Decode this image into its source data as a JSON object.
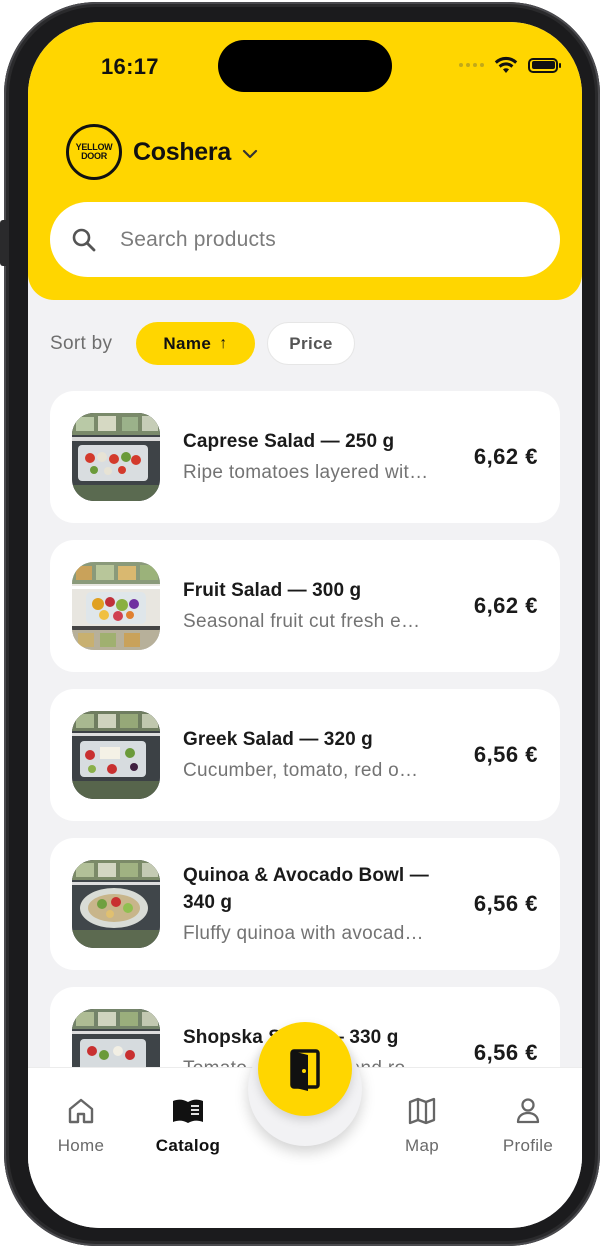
{
  "status_bar": {
    "time": "16:17"
  },
  "header": {
    "logo_line1": "YELLOW",
    "logo_line2": "DOOR",
    "store_name": "Coshera"
  },
  "search": {
    "placeholder": "Search products",
    "value": ""
  },
  "sort": {
    "label": "Sort by",
    "options": [
      {
        "label": "Name",
        "active": true,
        "direction": "↑"
      },
      {
        "label": "Price",
        "active": false
      }
    ]
  },
  "products": [
    {
      "title": "Caprese Salad — 250 g",
      "description": "Ripe tomatoes layered wit…",
      "price": "6,62 €"
    },
    {
      "title": "Fruit Salad — 300 g",
      "description": "Seasonal fruit cut fresh e…",
      "price": "6,62 €"
    },
    {
      "title": "Greek Salad — 320 g",
      "description": "Cucumber, tomato, red o…",
      "price": "6,56 €"
    },
    {
      "title": "Quinoa & Avocado Bowl — 340 g",
      "description": "Fluffy quinoa with avocad…",
      "price": "6,56 €"
    },
    {
      "title": "Shopska Salad — 330 g",
      "description": "Tomato, cucumber and ro…",
      "price": "6,56 €"
    }
  ],
  "bottom_nav": {
    "items": [
      {
        "label": "Home",
        "icon": "home-icon",
        "active": false
      },
      {
        "label": "Catalog",
        "icon": "book-icon",
        "active": true
      },
      {
        "label": "Map",
        "icon": "map-icon",
        "active": false
      },
      {
        "label": "Profile",
        "icon": "person-icon",
        "active": false
      }
    ],
    "fab_icon": "door-icon"
  },
  "colors": {
    "accent": "#ffd600",
    "background": "#f2f2f4",
    "text": "#111111",
    "muted": "#737373"
  }
}
